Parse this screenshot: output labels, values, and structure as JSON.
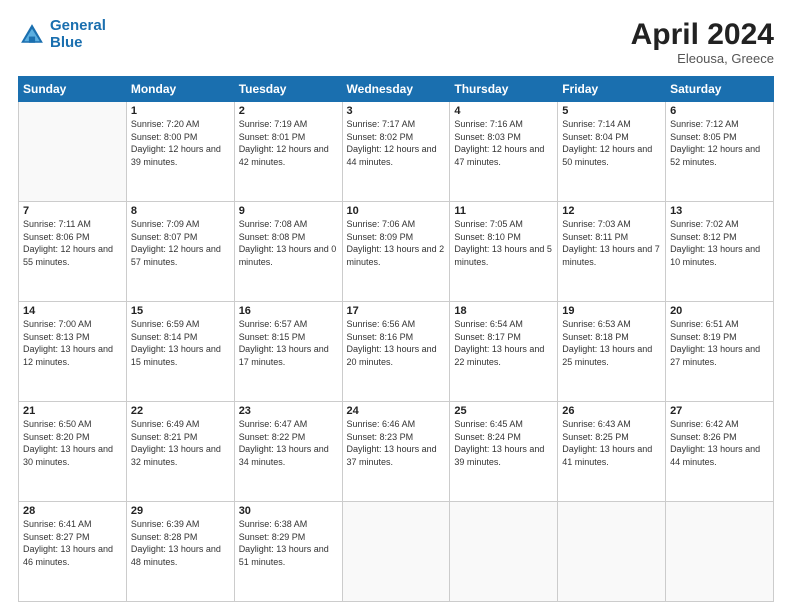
{
  "header": {
    "logo_line1": "General",
    "logo_line2": "Blue",
    "month": "April 2024",
    "location": "Eleousa, Greece"
  },
  "weekdays": [
    "Sunday",
    "Monday",
    "Tuesday",
    "Wednesday",
    "Thursday",
    "Friday",
    "Saturday"
  ],
  "weeks": [
    [
      {
        "day": "",
        "sunrise": "",
        "sunset": "",
        "daylight": ""
      },
      {
        "day": "1",
        "sunrise": "Sunrise: 7:20 AM",
        "sunset": "Sunset: 8:00 PM",
        "daylight": "Daylight: 12 hours and 39 minutes."
      },
      {
        "day": "2",
        "sunrise": "Sunrise: 7:19 AM",
        "sunset": "Sunset: 8:01 PM",
        "daylight": "Daylight: 12 hours and 42 minutes."
      },
      {
        "day": "3",
        "sunrise": "Sunrise: 7:17 AM",
        "sunset": "Sunset: 8:02 PM",
        "daylight": "Daylight: 12 hours and 44 minutes."
      },
      {
        "day": "4",
        "sunrise": "Sunrise: 7:16 AM",
        "sunset": "Sunset: 8:03 PM",
        "daylight": "Daylight: 12 hours and 47 minutes."
      },
      {
        "day": "5",
        "sunrise": "Sunrise: 7:14 AM",
        "sunset": "Sunset: 8:04 PM",
        "daylight": "Daylight: 12 hours and 50 minutes."
      },
      {
        "day": "6",
        "sunrise": "Sunrise: 7:12 AM",
        "sunset": "Sunset: 8:05 PM",
        "daylight": "Daylight: 12 hours and 52 minutes."
      }
    ],
    [
      {
        "day": "7",
        "sunrise": "Sunrise: 7:11 AM",
        "sunset": "Sunset: 8:06 PM",
        "daylight": "Daylight: 12 hours and 55 minutes."
      },
      {
        "day": "8",
        "sunrise": "Sunrise: 7:09 AM",
        "sunset": "Sunset: 8:07 PM",
        "daylight": "Daylight: 12 hours and 57 minutes."
      },
      {
        "day": "9",
        "sunrise": "Sunrise: 7:08 AM",
        "sunset": "Sunset: 8:08 PM",
        "daylight": "Daylight: 13 hours and 0 minutes."
      },
      {
        "day": "10",
        "sunrise": "Sunrise: 7:06 AM",
        "sunset": "Sunset: 8:09 PM",
        "daylight": "Daylight: 13 hours and 2 minutes."
      },
      {
        "day": "11",
        "sunrise": "Sunrise: 7:05 AM",
        "sunset": "Sunset: 8:10 PM",
        "daylight": "Daylight: 13 hours and 5 minutes."
      },
      {
        "day": "12",
        "sunrise": "Sunrise: 7:03 AM",
        "sunset": "Sunset: 8:11 PM",
        "daylight": "Daylight: 13 hours and 7 minutes."
      },
      {
        "day": "13",
        "sunrise": "Sunrise: 7:02 AM",
        "sunset": "Sunset: 8:12 PM",
        "daylight": "Daylight: 13 hours and 10 minutes."
      }
    ],
    [
      {
        "day": "14",
        "sunrise": "Sunrise: 7:00 AM",
        "sunset": "Sunset: 8:13 PM",
        "daylight": "Daylight: 13 hours and 12 minutes."
      },
      {
        "day": "15",
        "sunrise": "Sunrise: 6:59 AM",
        "sunset": "Sunset: 8:14 PM",
        "daylight": "Daylight: 13 hours and 15 minutes."
      },
      {
        "day": "16",
        "sunrise": "Sunrise: 6:57 AM",
        "sunset": "Sunset: 8:15 PM",
        "daylight": "Daylight: 13 hours and 17 minutes."
      },
      {
        "day": "17",
        "sunrise": "Sunrise: 6:56 AM",
        "sunset": "Sunset: 8:16 PM",
        "daylight": "Daylight: 13 hours and 20 minutes."
      },
      {
        "day": "18",
        "sunrise": "Sunrise: 6:54 AM",
        "sunset": "Sunset: 8:17 PM",
        "daylight": "Daylight: 13 hours and 22 minutes."
      },
      {
        "day": "19",
        "sunrise": "Sunrise: 6:53 AM",
        "sunset": "Sunset: 8:18 PM",
        "daylight": "Daylight: 13 hours and 25 minutes."
      },
      {
        "day": "20",
        "sunrise": "Sunrise: 6:51 AM",
        "sunset": "Sunset: 8:19 PM",
        "daylight": "Daylight: 13 hours and 27 minutes."
      }
    ],
    [
      {
        "day": "21",
        "sunrise": "Sunrise: 6:50 AM",
        "sunset": "Sunset: 8:20 PM",
        "daylight": "Daylight: 13 hours and 30 minutes."
      },
      {
        "day": "22",
        "sunrise": "Sunrise: 6:49 AM",
        "sunset": "Sunset: 8:21 PM",
        "daylight": "Daylight: 13 hours and 32 minutes."
      },
      {
        "day": "23",
        "sunrise": "Sunrise: 6:47 AM",
        "sunset": "Sunset: 8:22 PM",
        "daylight": "Daylight: 13 hours and 34 minutes."
      },
      {
        "day": "24",
        "sunrise": "Sunrise: 6:46 AM",
        "sunset": "Sunset: 8:23 PM",
        "daylight": "Daylight: 13 hours and 37 minutes."
      },
      {
        "day": "25",
        "sunrise": "Sunrise: 6:45 AM",
        "sunset": "Sunset: 8:24 PM",
        "daylight": "Daylight: 13 hours and 39 minutes."
      },
      {
        "day": "26",
        "sunrise": "Sunrise: 6:43 AM",
        "sunset": "Sunset: 8:25 PM",
        "daylight": "Daylight: 13 hours and 41 minutes."
      },
      {
        "day": "27",
        "sunrise": "Sunrise: 6:42 AM",
        "sunset": "Sunset: 8:26 PM",
        "daylight": "Daylight: 13 hours and 44 minutes."
      }
    ],
    [
      {
        "day": "28",
        "sunrise": "Sunrise: 6:41 AM",
        "sunset": "Sunset: 8:27 PM",
        "daylight": "Daylight: 13 hours and 46 minutes."
      },
      {
        "day": "29",
        "sunrise": "Sunrise: 6:39 AM",
        "sunset": "Sunset: 8:28 PM",
        "daylight": "Daylight: 13 hours and 48 minutes."
      },
      {
        "day": "30",
        "sunrise": "Sunrise: 6:38 AM",
        "sunset": "Sunset: 8:29 PM",
        "daylight": "Daylight: 13 hours and 51 minutes."
      },
      {
        "day": "",
        "sunrise": "",
        "sunset": "",
        "daylight": ""
      },
      {
        "day": "",
        "sunrise": "",
        "sunset": "",
        "daylight": ""
      },
      {
        "day": "",
        "sunrise": "",
        "sunset": "",
        "daylight": ""
      },
      {
        "day": "",
        "sunrise": "",
        "sunset": "",
        "daylight": ""
      }
    ]
  ]
}
